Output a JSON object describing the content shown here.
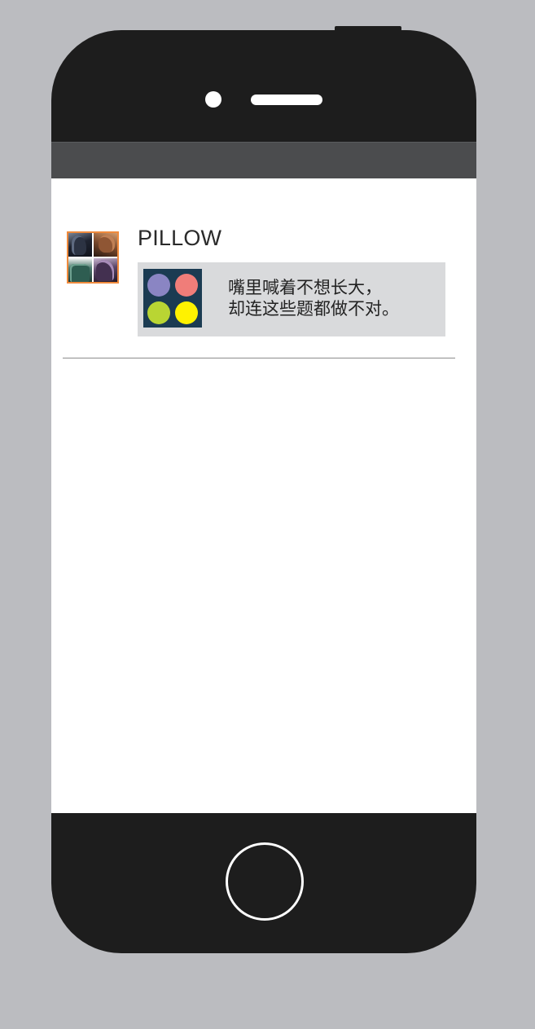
{
  "post": {
    "username": "PILLOW",
    "share_text_line1": "嘴里喊着不想长大，",
    "share_text_line2": "却连这些题都做不对。"
  },
  "colors": {
    "background": "#bbbcc0",
    "phone_body": "#1d1d1d",
    "status_bar": "#4b4c4e",
    "avatar_border": "#ef8a3c",
    "share_card": "#d9dadc",
    "thumb_background": "#1b3b52",
    "dot_purple": "#8a85c3",
    "dot_red": "#f07d79",
    "dot_green": "#b9d533",
    "dot_yellow": "#fff200"
  },
  "icons": {
    "camera": "camera-icon",
    "speaker": "speaker-icon",
    "home": "home-button-icon",
    "avatar": "avatar-image",
    "share_thumb": "four-dots-icon"
  }
}
